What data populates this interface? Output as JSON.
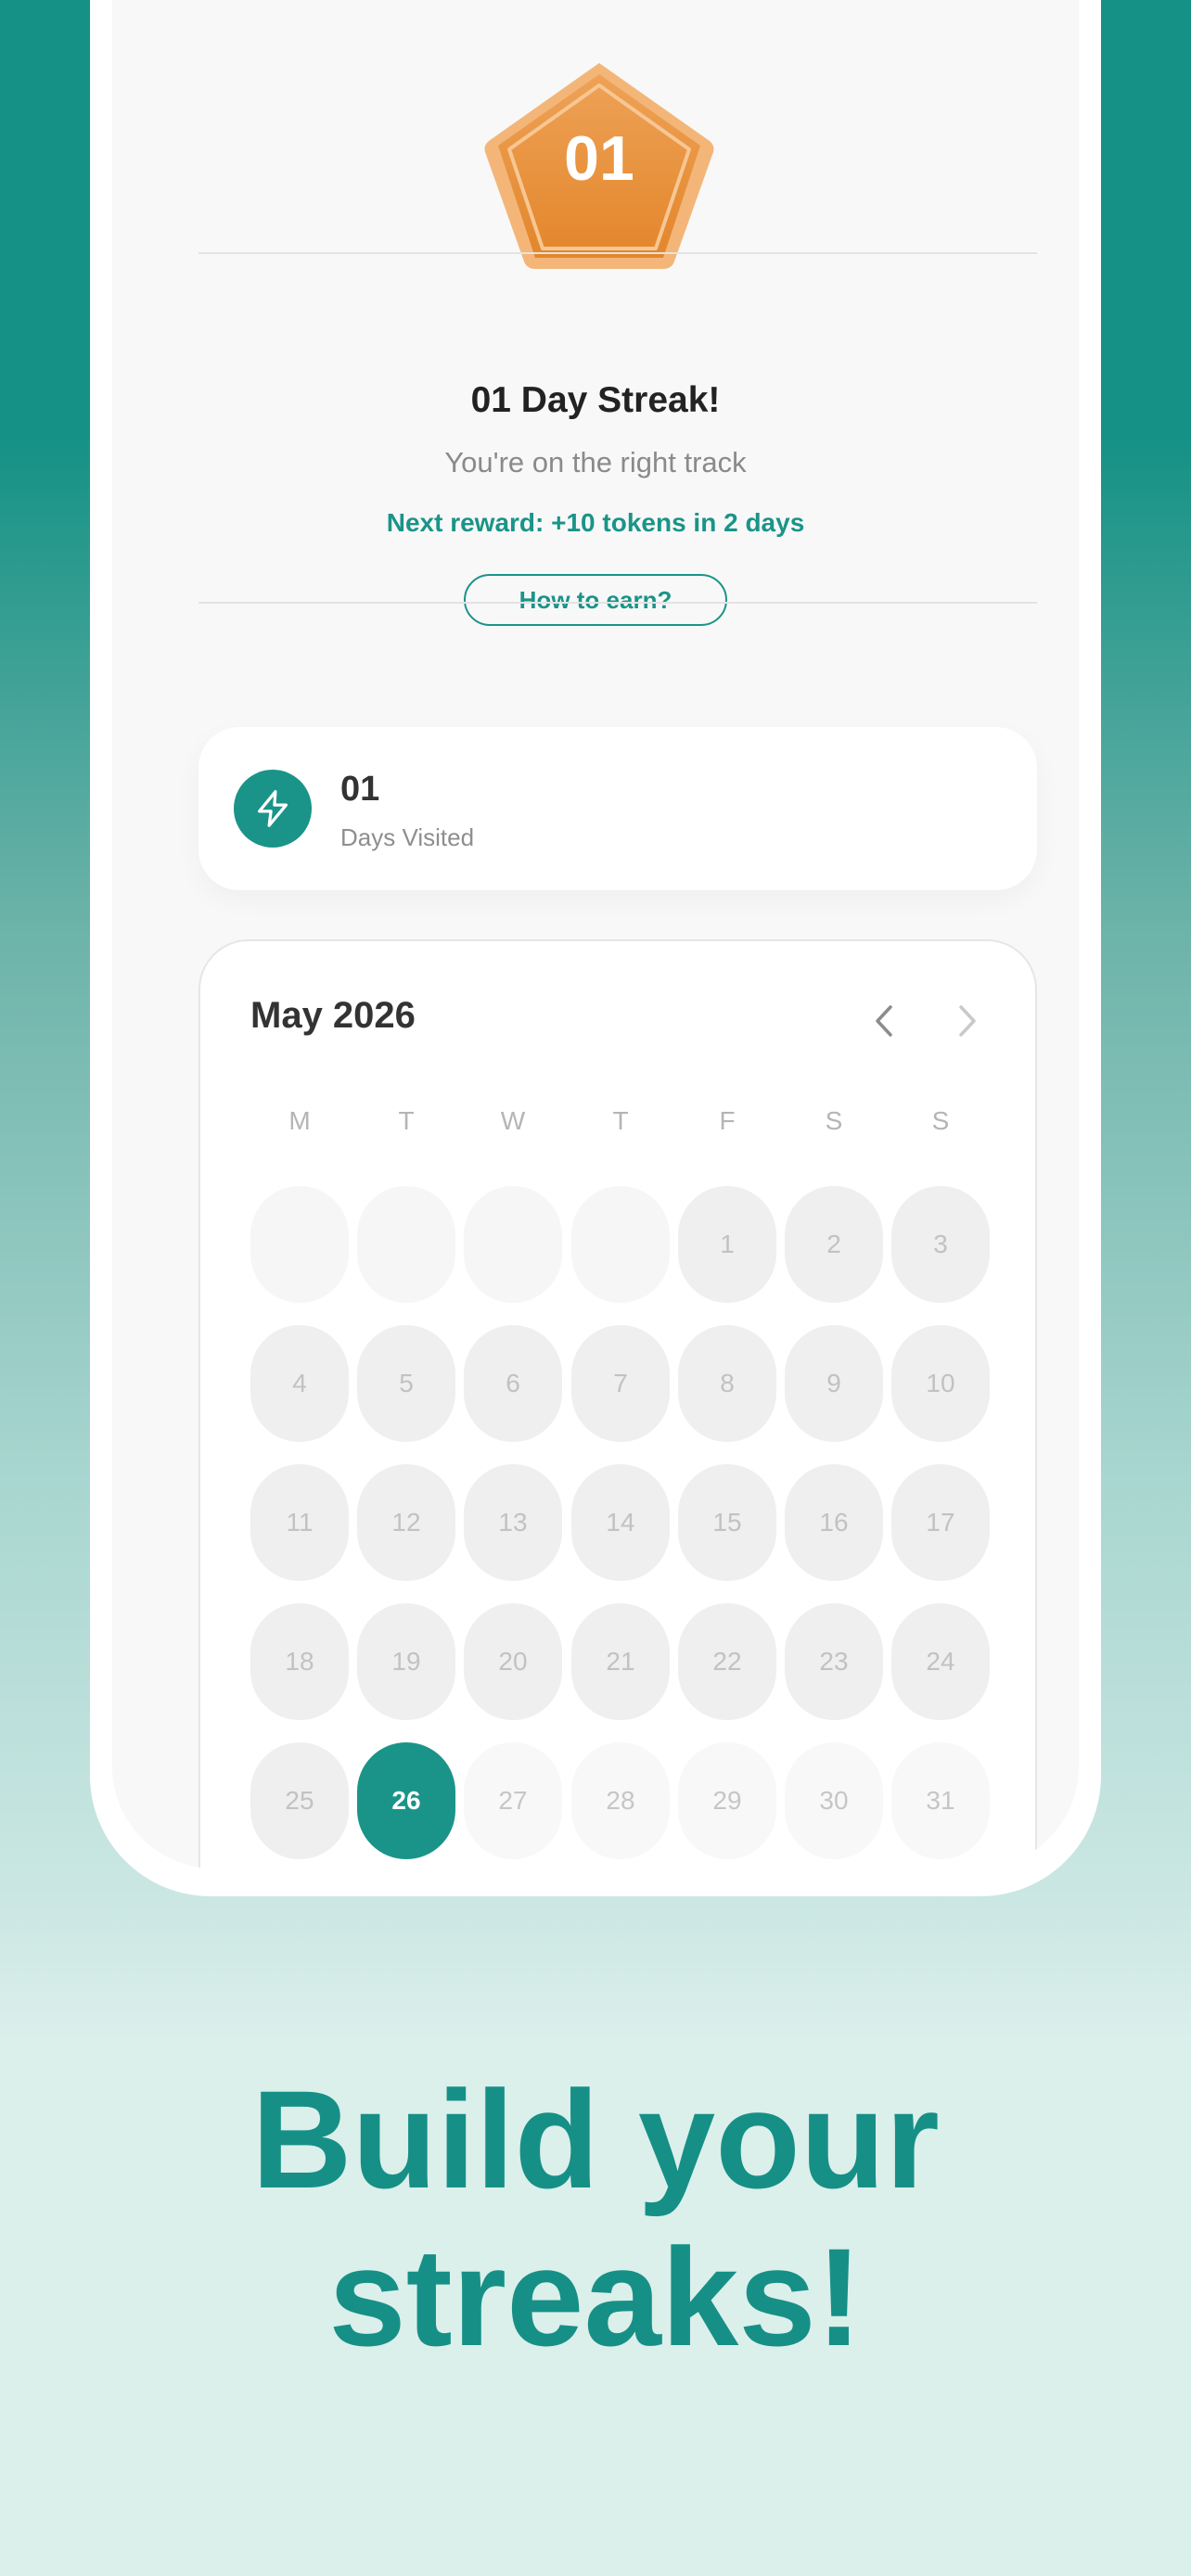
{
  "colors": {
    "accent": "#1a9488",
    "badge_orange": "#e8923a",
    "headline": "#169086"
  },
  "badge": {
    "number": "01",
    "icon": "pentagon-badge"
  },
  "streak": {
    "title": "01 Day Streak!",
    "subtitle": "You're on the right track",
    "reward": "Next reward: +10 tokens in 2 days",
    "how_button": "How to earn?"
  },
  "stat": {
    "icon": "lightning-icon",
    "value": "01",
    "label": "Days Visited"
  },
  "calendar": {
    "month": "May 2026",
    "weekdays": [
      "M",
      "T",
      "W",
      "T",
      "F",
      "S",
      "S"
    ],
    "days": [
      "",
      "",
      "",
      "",
      "1",
      "2",
      "3",
      "4",
      "5",
      "6",
      "7",
      "8",
      "9",
      "10",
      "11",
      "12",
      "13",
      "14",
      "15",
      "16",
      "17",
      "18",
      "19",
      "20",
      "21",
      "22",
      "23",
      "24",
      "25",
      "26",
      "27",
      "28",
      "29",
      "30",
      "31"
    ],
    "today": "26"
  },
  "headline": {
    "line1": "Build your",
    "line2": "streaks!"
  }
}
